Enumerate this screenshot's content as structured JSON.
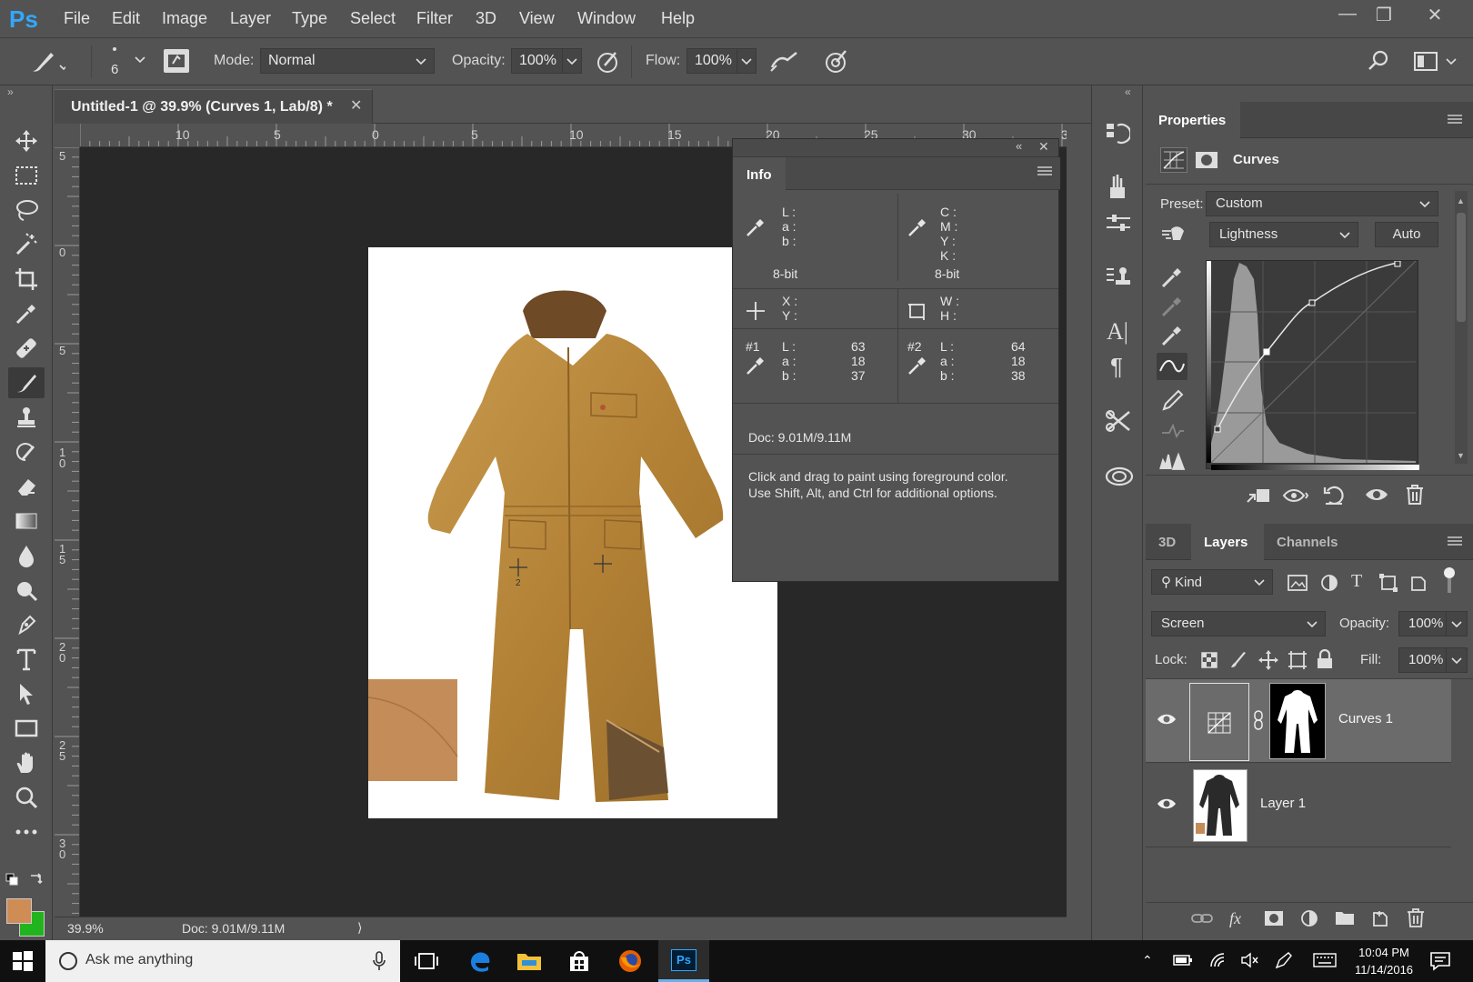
{
  "app": {
    "logo": "Ps"
  },
  "menu": [
    "File",
    "Edit",
    "Image",
    "Layer",
    "Type",
    "Select",
    "Filter",
    "3D",
    "View",
    "Window",
    "Help"
  ],
  "options": {
    "brush_size": "6",
    "mode_label": "Mode:",
    "mode_value": "Normal",
    "opacity_label": "Opacity:",
    "opacity_value": "100%",
    "flow_label": "Flow:",
    "flow_value": "100%"
  },
  "document": {
    "tab_title": "Untitled-1 @ 39.9% (Curves 1, Lab/8) *",
    "ruler_top": [
      "10",
      "5",
      "0",
      "5",
      "10",
      "15",
      "20",
      "25",
      "30",
      "3"
    ],
    "ruler_left": [
      "5",
      "0",
      "5",
      "1 0",
      "1 5",
      "2 0",
      "2 5",
      "3 0"
    ]
  },
  "status": {
    "zoom": "39.9%",
    "doc": "Doc: 9.01M/9.11M"
  },
  "info_panel": {
    "tab": "Info",
    "lab_labels": [
      "L :",
      "a :",
      "b :"
    ],
    "cmyk_labels": [
      "C :",
      "M :",
      "Y :",
      "K :"
    ],
    "bit_left": "8-bit",
    "bit_right": "8-bit",
    "xy_labels": [
      "X :",
      "Y :"
    ],
    "wh_labels": [
      "W :",
      "H :"
    ],
    "sample1": {
      "id": "#1",
      "labels": [
        "L :",
        "a :",
        "b :"
      ],
      "values": [
        "63",
        "18",
        "37"
      ]
    },
    "sample2": {
      "id": "#2",
      "labels": [
        "L :",
        "a :",
        "b :"
      ],
      "values": [
        "64",
        "18",
        "38"
      ]
    },
    "doc": "Doc: 9.01M/9.11M",
    "hint_line1": "Click and drag to paint using foreground color.",
    "hint_line2": "Use Shift, Alt, and Ctrl for additional options."
  },
  "properties": {
    "tab": "Properties",
    "title": "Curves",
    "preset_label": "Preset:",
    "preset_value": "Custom",
    "channel_value": "Lightness",
    "auto_label": "Auto"
  },
  "layers_panel": {
    "tabs": [
      "3D",
      "Layers",
      "Channels"
    ],
    "kind_label": "Kind",
    "blend_mode": "Screen",
    "opacity_label": "Opacity:",
    "opacity_value": "100%",
    "lock_label": "Lock:",
    "fill_label": "Fill:",
    "fill_value": "100%",
    "layers": [
      {
        "name": "Curves 1",
        "selected": true
      },
      {
        "name": "Layer 1",
        "selected": false
      }
    ]
  },
  "taskbar": {
    "search_placeholder": "Ask me anything",
    "time": "10:04 PM",
    "date": "11/14/2016"
  },
  "colors": {
    "foreground": "#d08c55",
    "background": "#22b41e",
    "accent": "#31a8ff"
  }
}
